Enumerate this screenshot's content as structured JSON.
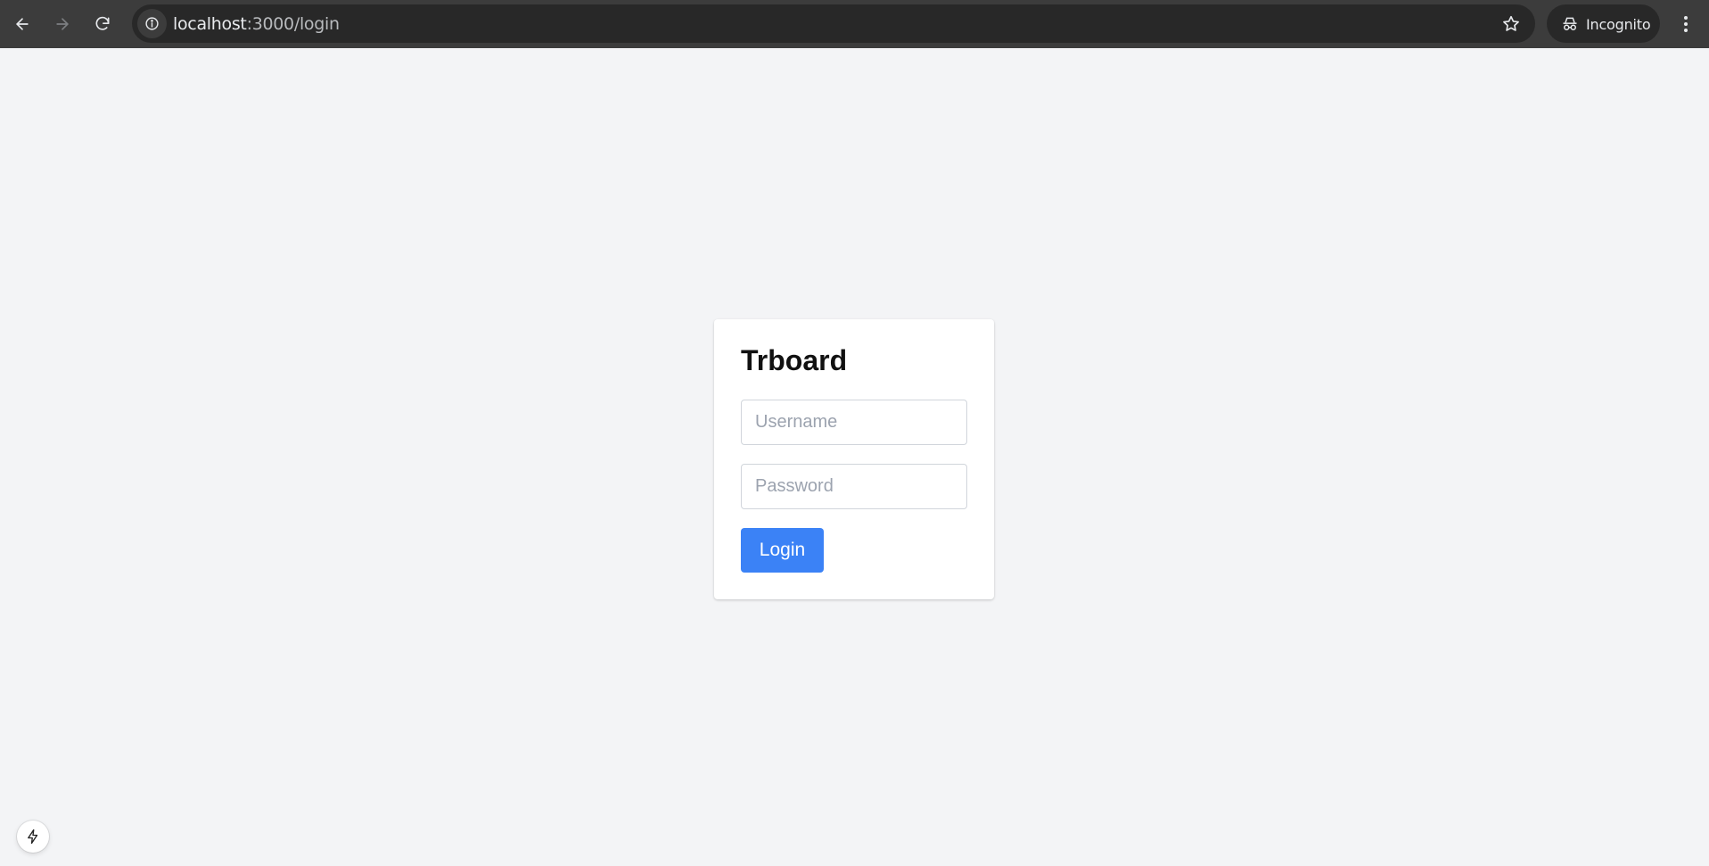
{
  "browser": {
    "url_host": "localhost",
    "url_path": ":3000/login",
    "profile_label": "Incognito",
    "icons": {
      "back": "arrow-left-icon",
      "forward": "arrow-right-icon",
      "reload": "reload-icon",
      "site_info": "info-icon",
      "bookmark": "star-icon",
      "incognito": "incognito-icon",
      "menu": "kebab-menu-icon"
    }
  },
  "login": {
    "title": "Trboard",
    "username_placeholder": "Username",
    "username_value": "",
    "password_placeholder": "Password",
    "password_value": "",
    "submit_label": "Login"
  },
  "dev_indicator": {
    "icon": "lightning-bolt-icon"
  },
  "colors": {
    "page_background": "#f3f4f6",
    "primary_button": "#3b82f6",
    "browser_toolbar": "#3c3c3c",
    "omnibox": "#282828"
  }
}
